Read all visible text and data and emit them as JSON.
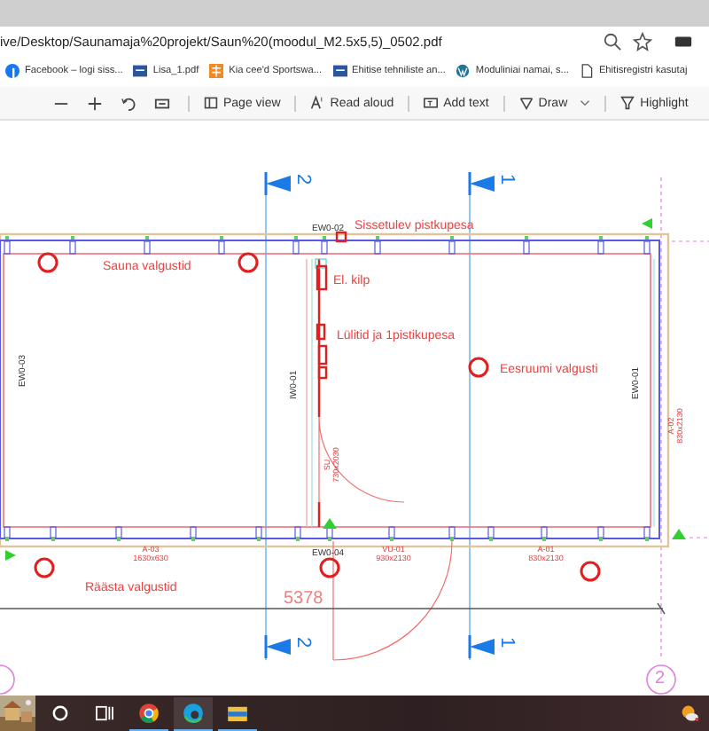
{
  "address_bar": {
    "url": "ive/Desktop/Saunamaja%20projekt/Saun%20(moodul_M2.5x5,5)_0502.pdf"
  },
  "bookmarks": [
    {
      "label": "Facebook – logi siss...",
      "kind": "facebook"
    },
    {
      "label": "Lisa_1.pdf",
      "kind": "doc"
    },
    {
      "label": "Kia cee'd Sportswa...",
      "kind": "orange"
    },
    {
      "label": "Ehitise tehniliste an...",
      "kind": "doc"
    },
    {
      "label": "Moduliniai namai, s...",
      "kind": "wordpress"
    },
    {
      "label": "Ehitisregistri kasutaj",
      "kind": "page"
    }
  ],
  "pdf_toolbar": {
    "buttons": [
      {
        "label": "Page view",
        "kind": "page-view"
      },
      {
        "label": "Read aloud",
        "kind": "read-aloud"
      },
      {
        "label": "Add text",
        "kind": "add-text"
      },
      {
        "label": "Draw",
        "kind": "draw"
      },
      {
        "label": "Highlight",
        "kind": "highlight"
      }
    ]
  },
  "drawing": {
    "section_markers": [
      "2",
      "1",
      "2",
      "1"
    ],
    "notes": [
      "Sissetulev pistkupesa",
      "Sauna valgustid",
      "El. kilp",
      "Lülitid ja 1pistikupesa",
      "Eesruumi valgusti",
      "Räästa valgustid"
    ],
    "wall_tags": [
      "EW0-02",
      "EW0-03",
      "IW0-01",
      "EW0-01",
      "EW0-04"
    ],
    "openings": [
      {
        "code": "A-02",
        "size": "830x2130"
      },
      {
        "code": "SU",
        "size": "730x2030"
      },
      {
        "code": "A-03",
        "size": "1630x630"
      },
      {
        "code": "VU-01",
        "size": "930x2130"
      },
      {
        "code": "A-01",
        "size": "830x2130"
      }
    ],
    "dimension": "5378",
    "grid_marker": "2"
  }
}
